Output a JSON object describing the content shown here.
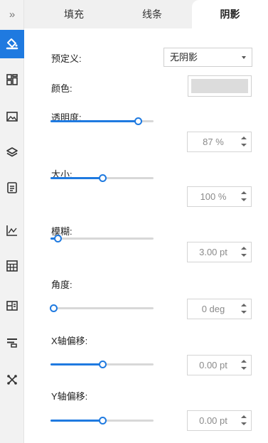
{
  "colors": {
    "accent": "#1f7ae0",
    "track": "#d8d8d8",
    "swatch": "#dcdcdc",
    "value_text": "#8a8a8a"
  },
  "rail": {
    "collapse_glyph": "»",
    "items": [
      {
        "icon": "fill-bucket-icon",
        "active": true
      },
      {
        "icon": "grid-icon"
      },
      {
        "icon": "image-icon"
      },
      {
        "icon": "layers-icon"
      },
      {
        "icon": "document-icon"
      },
      {
        "icon": "chart-icon"
      },
      {
        "icon": "table-icon"
      },
      {
        "icon": "building-icon"
      },
      {
        "icon": "toolbar-icon"
      },
      {
        "icon": "network-icon"
      }
    ]
  },
  "tabs": [
    {
      "label": "填充"
    },
    {
      "label": "线条"
    },
    {
      "label": "阴影",
      "active": true
    }
  ],
  "shadow": {
    "preset_label": "预定义:",
    "preset_value": "无阴影",
    "color_label": "颜色:",
    "opacity": {
      "label": "透明度:",
      "value": "87 %",
      "level": 0.85
    },
    "size": {
      "label": "大小:",
      "value": "100 %",
      "level": 0.5
    },
    "blur": {
      "label": "模糊:",
      "value": "3.00 pt",
      "level": 0.07
    },
    "angle": {
      "label": "角度:",
      "value": "0 deg",
      "level": 0.03
    },
    "x_offset": {
      "label": "X轴偏移:",
      "value": "0.00 pt",
      "level": 0.5
    },
    "y_offset": {
      "label": "Y轴偏移:",
      "value": "0.00 pt",
      "level": 0.5
    }
  }
}
